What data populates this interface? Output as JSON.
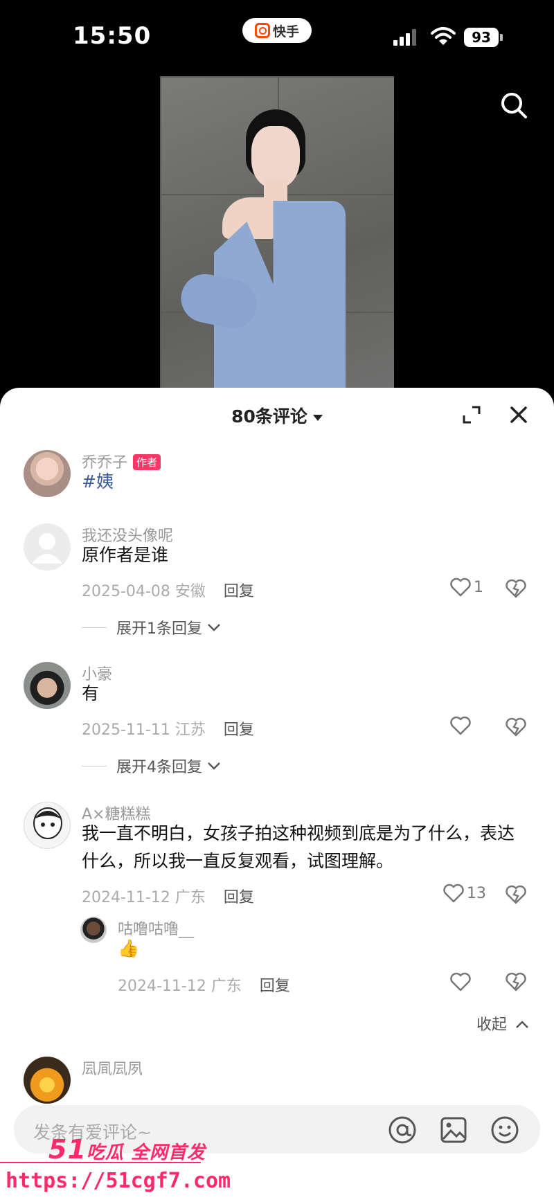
{
  "status_bar": {
    "time": "15:50",
    "app_name": "快手",
    "battery": "93"
  },
  "comments_panel": {
    "title": "80条评论",
    "comments": [
      {
        "author": "乔乔子",
        "badge": "作者",
        "text": "#姨"
      },
      {
        "author": "我还没头像呢",
        "text": "原作者是谁",
        "date": "2025-04-08 安徽",
        "reply_label": "回复",
        "likes": "1",
        "expand": "展开1条回复"
      },
      {
        "author": "小豪",
        "text": "有",
        "date": "2025-11-11 江苏",
        "reply_label": "回复",
        "likes": "",
        "expand": "展开4条回复"
      },
      {
        "author": "A×糖糕糕",
        "text": "我一直不明白，女孩子拍这种视频到底是为了什么，表达什么，所以我一直反复观看，试图理解。",
        "date": "2024-11-12 广东",
        "reply_label": "回复",
        "likes": "13",
        "reply": {
          "author": "咕噜咕噜__",
          "text": "👍",
          "date": "2024-11-12 广东",
          "reply_label": "回复"
        },
        "collapse": "收起"
      },
      {
        "author": "凨凬凨夙",
        "text": ""
      }
    ]
  },
  "input": {
    "placeholder": "发条有爱评论~"
  },
  "watermark": {
    "line1_big": "51",
    "line1": "吃瓜 全网首发",
    "url": "https://51cgf7.com"
  },
  "colors": {
    "author_badge": "#fe3666",
    "watermark": "#ff2a6a"
  }
}
